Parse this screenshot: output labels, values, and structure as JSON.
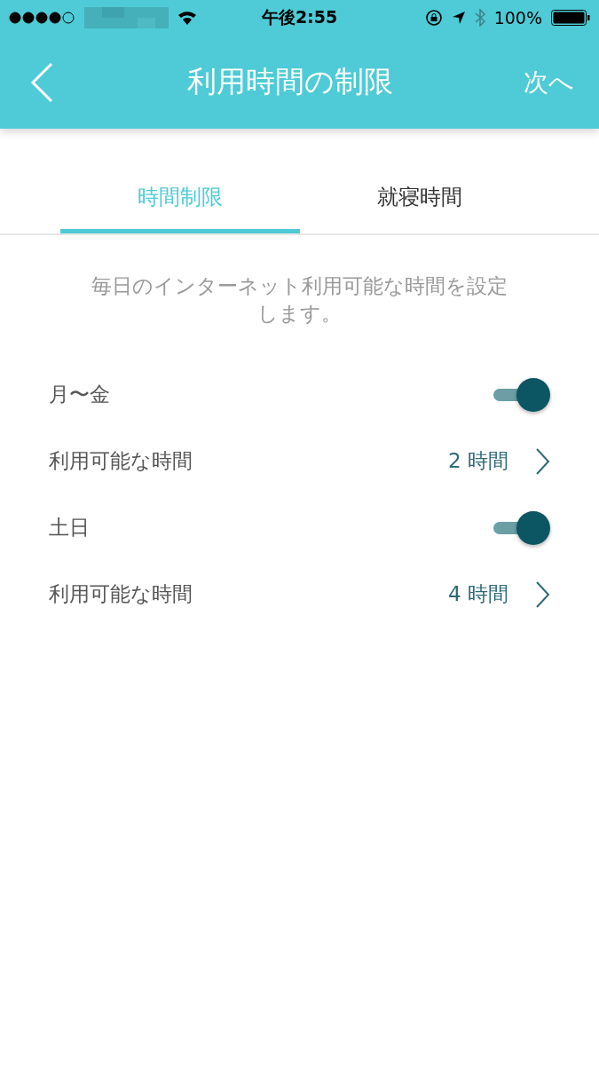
{
  "status_bar": {
    "time": "午後2:55",
    "battery": "100%"
  },
  "nav": {
    "title": "利用時間の制限",
    "next": "次へ"
  },
  "tabs": [
    {
      "label": "時間制限",
      "selected": true
    },
    {
      "label": "就寝時間",
      "selected": false
    }
  ],
  "description": "毎日のインターネット利用可能な時間を設定します。",
  "rows": [
    {
      "kind": "toggle",
      "label": "月〜金",
      "on": true
    },
    {
      "kind": "value",
      "label": "利用可能な時間",
      "value": "2 時間"
    },
    {
      "kind": "toggle",
      "label": "土日",
      "on": true
    },
    {
      "kind": "value",
      "label": "利用可能な時間",
      "value": "4 時間"
    }
  ]
}
